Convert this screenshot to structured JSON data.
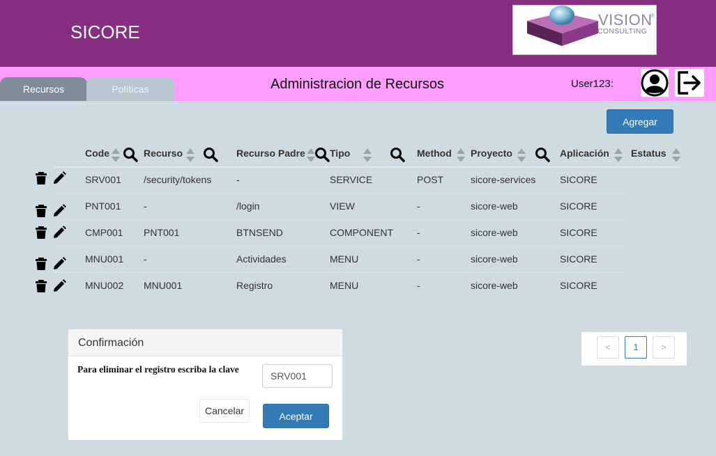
{
  "header": {
    "app_title": "SICORE",
    "logo": {
      "word": "VISION",
      "sub": "CONSULTING",
      "reg": "®"
    }
  },
  "nav": {
    "tabs": [
      {
        "label": "Recursos",
        "active": true
      },
      {
        "label": "Políticas",
        "active": false
      }
    ],
    "page_title": "Administracion de Recursos",
    "user_label": "User123:"
  },
  "toolbar": {
    "add_label": "Agregar"
  },
  "table": {
    "columns": [
      "Code",
      "Recurso",
      "Recurso Padre",
      "Tipo",
      "Method",
      "Proyecto",
      "Aplicación",
      "Estatus"
    ],
    "rows": [
      [
        "SRV001",
        "/security/tokens",
        "-",
        "SERVICE",
        "POST",
        "sicore-services",
        "SICORE",
        ""
      ],
      [
        "PNT001",
        "-",
        "/login",
        "VIEW",
        "-",
        "sicore-web",
        "SICORE",
        ""
      ],
      [
        "CMP001",
        "PNT001",
        "BTNSEND",
        "COMPONENT",
        "-",
        "sicore-web",
        "SICORE",
        ""
      ],
      [
        "MNU001",
        "-",
        "Actividades",
        "MENU",
        "-",
        "sicore-web",
        "SICORE",
        ""
      ],
      [
        "MNU002",
        "MNU001",
        "Registro",
        "MENU",
        "-",
        "sicore-web",
        "SICORE",
        ""
      ]
    ]
  },
  "modal": {
    "title": "Confirmación",
    "prompt": "Para eliminar el registro escriba la clave",
    "input_value": "SRV001",
    "cancel_label": "Cancelar",
    "accept_label": "Aceptar"
  },
  "pagination": {
    "prev": "<",
    "current": "1",
    "next": ">"
  },
  "colors": {
    "header_bg": "#862e82",
    "subbar_bg": "#fd9dfd",
    "page_bg": "#cfdbe2",
    "primary": "#337ab7",
    "tab_active": "#808d98",
    "tab_inactive": "#b8c6cf"
  },
  "icons": {
    "user": "user-circle-icon",
    "logout": "logout-icon",
    "sort": "sort-icon",
    "search": "search-icon",
    "delete": "trash-icon",
    "edit": "pencil-icon"
  }
}
